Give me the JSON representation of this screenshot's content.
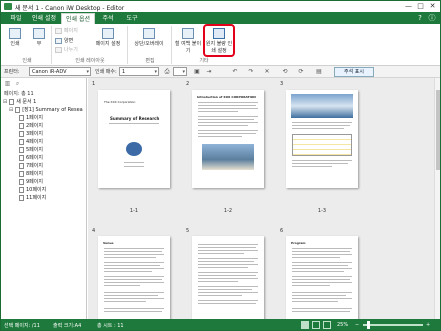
{
  "window": {
    "title": "새 문서 1 - Canon iW Desktop - Editor",
    "controls": {
      "minimize": "—",
      "maximize": "□",
      "close": "✕"
    }
  },
  "ribbon_tabs": [
    {
      "label": "파일"
    },
    {
      "label": "인쇄 설정"
    },
    {
      "label": "인쇄 옵션"
    },
    {
      "label": "주석"
    },
    {
      "label": "도구"
    }
  ],
  "ribbon": {
    "print_label": "인쇄",
    "copies_label": "부",
    "pages_label": "페이지",
    "sides_label": "양면",
    "next_label": "나누기",
    "page_setup_label": "페이지 설정",
    "overlay_label": "상단/오버레이",
    "binding_label": "철 여백 붙이기",
    "highlighted_label": "원지 불량 인쇄 설정",
    "group_print": "인쇄",
    "group_layout": "인쇄 레이아웃",
    "group_edit": "편집",
    "group_other": "기타"
  },
  "printer_bar": {
    "printer_label": "프린터:",
    "printer_value": "Canon iR-ADV",
    "print_count_label": "인쇄 매수:",
    "print_count_value": "1",
    "note_button": "주석 표시"
  },
  "nav": {
    "header": "페이지: 총 11",
    "doc_label": "새 문서 1",
    "section_label": "[장1] Summary of Resea",
    "pages": [
      "1페이지",
      "2페이지",
      "3페이지",
      "4페이지",
      "5페이지",
      "6페이지",
      "7페이지",
      "8페이지",
      "9페이지",
      "10페이지",
      "11페이지"
    ]
  },
  "thumbnails": [
    {
      "num": "1",
      "caption": "1-1",
      "heading": "The XXX Corporation",
      "title": "Summary of Research"
    },
    {
      "num": "2",
      "caption": "1-2",
      "heading": "Introduction of XXX CORPORATION"
    },
    {
      "num": "3",
      "caption": "1-3",
      "heading": ""
    },
    {
      "num": "4",
      "caption": "",
      "heading": "Venue"
    },
    {
      "num": "5",
      "caption": "",
      "heading": ""
    },
    {
      "num": "6",
      "caption": "",
      "heading": "Program"
    }
  ],
  "status": {
    "selection": "선택 페이지: /11",
    "paper": "출력 크기:A4",
    "sheets": "총 시트 : 11",
    "zoom": "25%"
  },
  "colors": {
    "brand": "#1e7a3c",
    "highlight": "#e2001a"
  }
}
